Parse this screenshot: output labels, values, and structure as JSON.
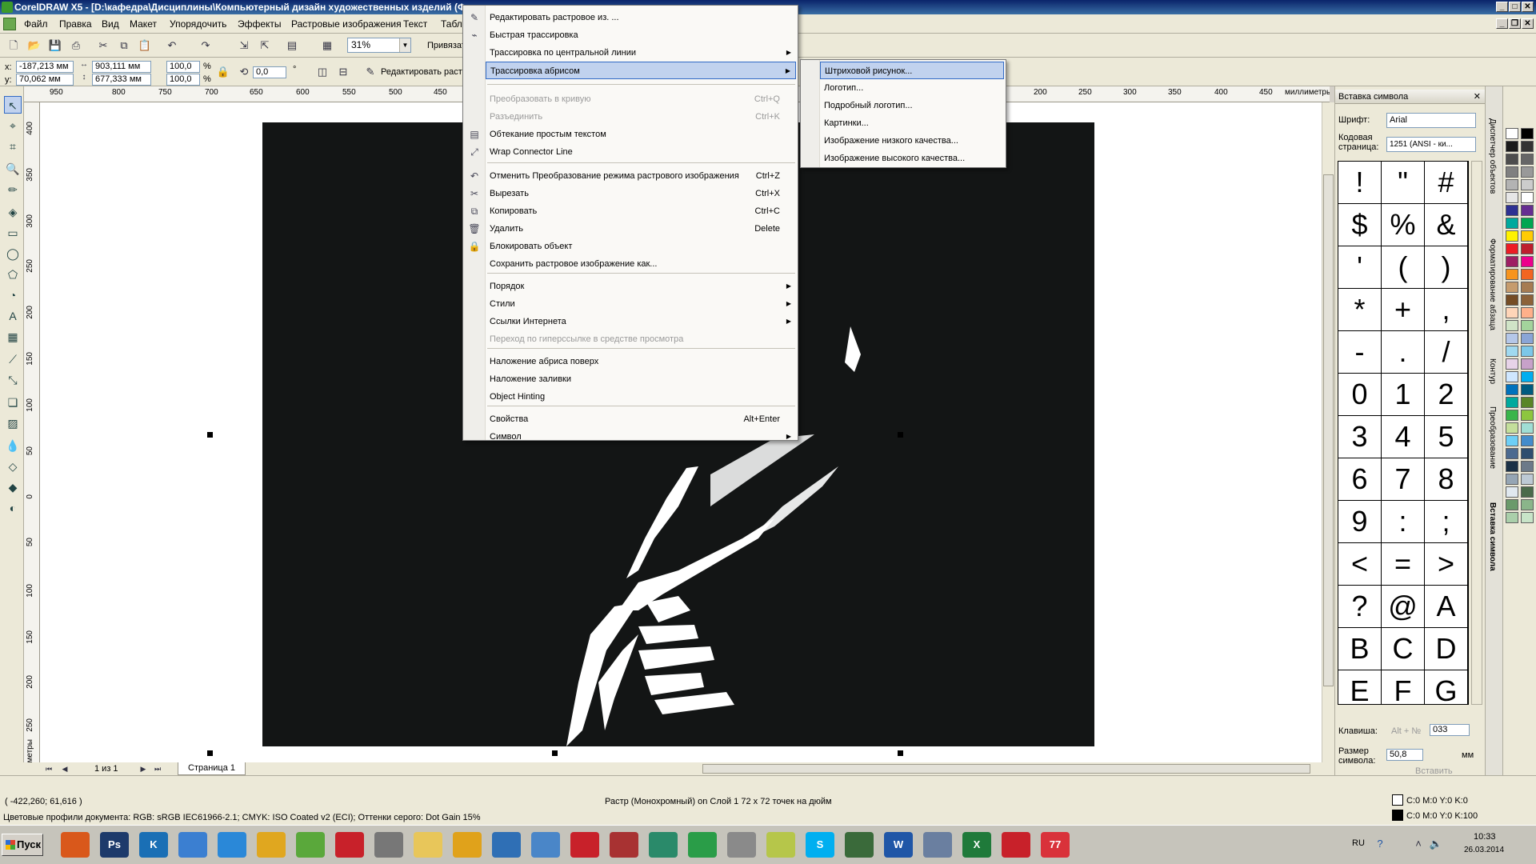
{
  "window": {
    "title": "CorelDRAW X5 - [D:\\кафедра\\Дисциплины\\Компьютерный дизайн художественных изделий (Ф"
  },
  "menubar": [
    "Файл",
    "Правка",
    "Вид",
    "Макет",
    "Упорядочить",
    "Эффекты",
    "Растровые изображения",
    "Текст",
    "Табли"
  ],
  "toolbar": {
    "zoom": "31%",
    "snap_label": "Привязать"
  },
  "propbar": {
    "x_label": "x:",
    "x": "-187,213 мм",
    "y_label": "y:",
    "y": "70,062 мм",
    "w": "903,111 мм",
    "h": "677,333 мм",
    "sx": "100,0",
    "sy": "100,0",
    "pct": "%",
    "pct2": "%",
    "angle": "0,0",
    "deg": "°",
    "edit_bitmap": "Редактировать растр"
  },
  "ruler": {
    "h_ticks": [
      "950",
      "800",
      "750",
      "700",
      "650",
      "600",
      "550",
      "500",
      "450",
      "200",
      "250",
      "300",
      "350",
      "400",
      "450"
    ],
    "unit": "миллиметры",
    "v_ticks": [
      "400",
      "350",
      "300",
      "250",
      "200",
      "150",
      "100",
      "50",
      "0",
      "50",
      "100",
      "150",
      "200",
      "250"
    ],
    "v_unit": "миллиметры"
  },
  "pages": {
    "count": "1 из 1",
    "tab": "Страница 1"
  },
  "status": {
    "coords": "( -422,260; 61,616 )",
    "object_info": "Растр (Монохромный) on Слой 1 72 x 72 точек на дюйм",
    "color_profiles": "Цветовые профили документа: RGB: sRGB IEC61966-2.1; CMYK: ISO Coated v2 (ECI); Оттенки серого: Dot Gain 15%",
    "fill": "C:0 M:0 Y:0 K:0",
    "outline": "C:0 M:0 Y:0 K:100"
  },
  "context_menu": {
    "items": [
      {
        "label": "Редактировать растровое из. ...",
        "shortcut": "",
        "disabled": false,
        "submenu": false
      },
      {
        "label": "Быстрая трассировка",
        "shortcut": "",
        "disabled": false,
        "submenu": false
      },
      {
        "label": "Трассировка по центральной линии",
        "shortcut": "",
        "disabled": false,
        "submenu": true
      },
      {
        "label": "Трассировка абрисом",
        "shortcut": "",
        "disabled": false,
        "submenu": true
      },
      {
        "label": "Преобразовать в кривую",
        "shortcut": "Ctrl+Q",
        "disabled": true,
        "submenu": false
      },
      {
        "label": "Разъединить",
        "shortcut": "Ctrl+K",
        "disabled": true,
        "submenu": false
      },
      {
        "label": "Обтекание простым текстом",
        "shortcut": "",
        "disabled": false,
        "submenu": false
      },
      {
        "label": "Wrap Connector Line",
        "shortcut": "",
        "disabled": false,
        "submenu": false
      },
      {
        "label": "Отменить Преобразование режима растрового изображения",
        "shortcut": "Ctrl+Z",
        "disabled": false,
        "submenu": false
      },
      {
        "label": "Вырезать",
        "shortcut": "Ctrl+X",
        "disabled": false,
        "submenu": false
      },
      {
        "label": "Копировать",
        "shortcut": "Ctrl+C",
        "disabled": false,
        "submenu": false
      },
      {
        "label": "Удалить",
        "shortcut": "Delete",
        "disabled": false,
        "submenu": false
      },
      {
        "label": "Блокировать объект",
        "shortcut": "",
        "disabled": false,
        "submenu": false
      },
      {
        "label": "Сохранить растровое изображение как...",
        "shortcut": "",
        "disabled": false,
        "submenu": false
      },
      {
        "label": "Порядок",
        "shortcut": "",
        "disabled": false,
        "submenu": true
      },
      {
        "label": "Стили",
        "shortcut": "",
        "disabled": false,
        "submenu": true
      },
      {
        "label": "Ссылки Интернета",
        "shortcut": "",
        "disabled": false,
        "submenu": true
      },
      {
        "label": "Переход по гиперссылке в средстве просмотра",
        "shortcut": "",
        "disabled": true,
        "submenu": false
      },
      {
        "label": "Наложение абриса поверх",
        "shortcut": "",
        "disabled": false,
        "submenu": false
      },
      {
        "label": "Наложение заливки",
        "shortcut": "",
        "disabled": false,
        "submenu": false
      },
      {
        "label": "Object Hinting",
        "shortcut": "",
        "disabled": false,
        "submenu": false
      },
      {
        "label": "Свойства",
        "shortcut": "Alt+Enter",
        "disabled": false,
        "submenu": false
      },
      {
        "label": "Символ",
        "shortcut": "",
        "disabled": false,
        "submenu": true
      }
    ]
  },
  "submenu": {
    "items": [
      "Штриховой рисунок...",
      "Логотип...",
      "Подробный логотип...",
      "Картинки...",
      "Изображение низкого качества...",
      "Изображение высокого качества..."
    ]
  },
  "docker": {
    "title": "Вставка символа",
    "font_label": "Шрифт:",
    "font": "Arial",
    "codepage_label": "Кодовая страница:",
    "codepage": "1251  (ANSI - ки...",
    "symbols": [
      "!",
      "\"",
      "#",
      "$",
      "%",
      "&",
      "'",
      "(",
      ")",
      "*",
      "+",
      ",",
      "-",
      ".",
      "/",
      "0",
      "1",
      "2",
      "3",
      "4",
      "5",
      "6",
      "7",
      "8",
      "9",
      ":",
      ";",
      "<",
      "=",
      ">",
      "?",
      "@",
      "A",
      "B",
      "C",
      "D",
      "E",
      "F",
      "G"
    ],
    "key_label": "Клавиша:",
    "key_hint": "Alt + №",
    "key_value": "033",
    "size_label": "Размер символа:",
    "size_value": "50,8",
    "size_unit": "мм",
    "insert_label": "Вставить"
  },
  "docker_tabs": [
    "Диспетчер объектов",
    "Форматирование абзаца",
    "Контур",
    "Преобразование",
    "Вставка символа"
  ],
  "taskbar": {
    "start": "Пуск",
    "lang": "RU",
    "time": "10:33",
    "date": "26.03.2014",
    "apps": [
      {
        "icon": "firefox-icon",
        "label": "",
        "color": "#d9581b"
      },
      {
        "icon": "photoshop-icon",
        "label": "Ps",
        "color": "#1d3a6b"
      },
      {
        "icon": "kaspersky-icon",
        "label": "K",
        "color": "#1a6fb5"
      },
      {
        "icon": "phone-icon",
        "label": "",
        "color": "#3b7fd1"
      },
      {
        "icon": "teamviewer-icon",
        "label": "",
        "color": "#2a88d8"
      },
      {
        "icon": "headphones-icon",
        "label": "",
        "color": "#e0a71f"
      },
      {
        "icon": "coreldraw-icon",
        "label": "",
        "color": "#5aa83b"
      },
      {
        "icon": "video-icon",
        "label": "",
        "color": "#c8212a"
      },
      {
        "icon": "camera-icon",
        "label": "",
        "color": "#777777"
      },
      {
        "icon": "folder-icon",
        "label": "",
        "color": "#e8c65a"
      },
      {
        "icon": "pen-icon",
        "label": "",
        "color": "#e0a21b"
      },
      {
        "icon": "monitor-icon",
        "label": "",
        "color": "#2f6fb5"
      },
      {
        "icon": "document-icon",
        "label": "",
        "color": "#4a86c8"
      },
      {
        "icon": "opera-icon",
        "label": "",
        "color": "#c8212a"
      },
      {
        "icon": "books-icon",
        "label": "",
        "color": "#a83232"
      },
      {
        "icon": "notepad-icon",
        "label": "",
        "color": "#2a8a6a"
      },
      {
        "icon": "chrome-icon",
        "label": "",
        "color": "#2a9d48"
      },
      {
        "icon": "printer-icon",
        "label": "",
        "color": "#8a8a8a"
      },
      {
        "icon": "notes-icon",
        "label": "",
        "color": "#b6c64a"
      },
      {
        "icon": "skype-icon",
        "label": "S",
        "color": "#00aff0"
      },
      {
        "icon": "cpu-icon",
        "label": "",
        "color": "#3a6a3a"
      },
      {
        "icon": "word-icon",
        "label": "W",
        "color": "#1f56a7"
      },
      {
        "icon": "calculator-icon",
        "label": "",
        "color": "#6a7fa0"
      },
      {
        "icon": "excel-icon",
        "label": "X",
        "color": "#1f7a3a"
      },
      {
        "icon": "acrobat-icon",
        "label": "",
        "color": "#c8212a"
      },
      {
        "icon": "calendar-icon",
        "label": "77",
        "color": "#d9323a"
      }
    ]
  },
  "palette_colors": [
    "#ffffff",
    "#000000",
    "#1a1a1a",
    "#333333",
    "#4d4d4d",
    "#666666",
    "#808080",
    "#999999",
    "#b3b3b3",
    "#cccccc",
    "#e6e6e6",
    "#ffffff",
    "#2e3192",
    "#662d91",
    "#00a99d",
    "#00a651",
    "#fff200",
    "#ffcb05",
    "#ed1c24",
    "#be1e2d",
    "#9e1f63",
    "#ec008c",
    "#f7941d",
    "#f26522",
    "#c69c6d",
    "#a67c52",
    "#754c24",
    "#8c6239",
    "#ffd5b8",
    "#ffb08a",
    "#d0e4c7",
    "#a3d39c",
    "#b5c7e8",
    "#8aa5d6",
    "#a0d9f0",
    "#7cc7e8",
    "#e7d3e8",
    "#c7a1c9",
    "#cfe7ff",
    "#00aeef",
    "#0072bc",
    "#005b7f",
    "#00a99d",
    "#598527",
    "#39b54a",
    "#8dc63f",
    "#c4df9b",
    "#a0ded4",
    "#6dcff6",
    "#448ccb",
    "#4b6a8f",
    "#2e4e6f",
    "#1b3146",
    "#6c7a89",
    "#95a5b4",
    "#bdc9d4",
    "#e0e8ef",
    "#4a6a4a",
    "#6a9a6a",
    "#8ab58a",
    "#aacfaa",
    "#c8e4c8"
  ]
}
